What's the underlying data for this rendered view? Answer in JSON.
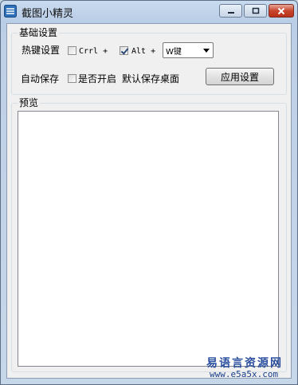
{
  "window": {
    "title": "截图小精灵",
    "app_icon": "scissors-app-icon"
  },
  "controls": {
    "minimize": "minimize-icon",
    "maximize": "maximize-icon",
    "close": "close-icon"
  },
  "basic": {
    "legend": "基础设置",
    "hotkey_label": "热键设置",
    "ctrl_label": "Crrl +",
    "ctrl_checked": false,
    "alt_label": "Alt +",
    "alt_checked": true,
    "key_select_value": "W键",
    "autosave_label": "自动保存",
    "autosave_option": "是否开启",
    "autosave_checked": false,
    "default_save": "默认保存桌面",
    "apply_button": "应用设置"
  },
  "preview": {
    "legend": "预览"
  },
  "watermark": {
    "line1": "易语言资源网",
    "line2": "www.e5a5x.com"
  },
  "colors": {
    "title_bg": "#b9cde6",
    "close_red": "#c8452d",
    "watermark": "#2b4f9e"
  }
}
